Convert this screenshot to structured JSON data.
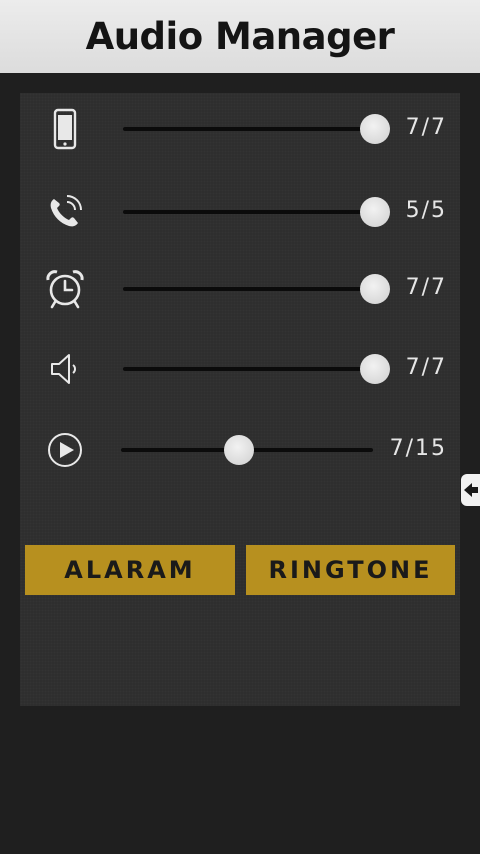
{
  "header": {
    "title": "Audio Manager"
  },
  "volume_rows": [
    {
      "name": "phone",
      "icon": "phone-device-icon",
      "current": 7,
      "max": 7,
      "label": "7/7"
    },
    {
      "name": "call",
      "icon": "phone-call-icon",
      "current": 5,
      "max": 5,
      "label": "5/5"
    },
    {
      "name": "alarm",
      "icon": "alarm-clock-icon",
      "current": 7,
      "max": 7,
      "label": "7/7"
    },
    {
      "name": "speaker",
      "icon": "speaker-icon",
      "current": 7,
      "max": 7,
      "label": "7/7"
    },
    {
      "name": "media",
      "icon": "play-icon",
      "current": 7,
      "max": 15,
      "label": "7/15"
    }
  ],
  "buttons": {
    "alarm_label": "ALARAM",
    "ringtone_label": "RINGTONE"
  },
  "colors": {
    "accent": "#b7901f",
    "panel": "#2e2e2e",
    "background": "#1f1f1f",
    "header": "#e4e4e4"
  }
}
